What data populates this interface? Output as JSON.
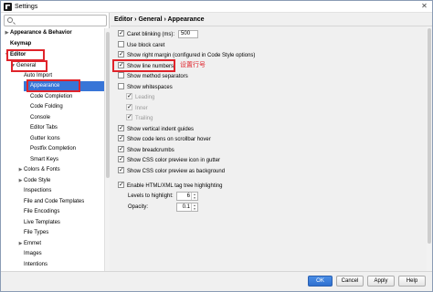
{
  "window": {
    "title": "Settings",
    "close_glyph": "✕"
  },
  "search": {
    "value": "",
    "placeholder": ""
  },
  "tree": [
    {
      "label": "Appearance & Behavior",
      "arrow": "▶",
      "bold": true
    },
    {
      "label": "Keymap",
      "arrow": "",
      "bold": true
    },
    {
      "label": "Editor",
      "arrow": "▼",
      "bold": true
    },
    {
      "label": "General",
      "arrow": "▼"
    },
    {
      "label": "Auto Import",
      "arrow": ""
    },
    {
      "label": "Appearance",
      "arrow": "",
      "selected": true
    },
    {
      "label": "Code Completion",
      "arrow": ""
    },
    {
      "label": "Code Folding",
      "arrow": ""
    },
    {
      "label": "Console",
      "arrow": ""
    },
    {
      "label": "Editor Tabs",
      "arrow": ""
    },
    {
      "label": "Gutter Icons",
      "arrow": ""
    },
    {
      "label": "Postfix Completion",
      "arrow": ""
    },
    {
      "label": "Smart Keys",
      "arrow": ""
    },
    {
      "label": "Colors & Fonts",
      "arrow": "▶"
    },
    {
      "label": "Code Style",
      "arrow": "▶"
    },
    {
      "label": "Inspections",
      "arrow": ""
    },
    {
      "label": "File and Code Templates",
      "arrow": ""
    },
    {
      "label": "File Encodings",
      "arrow": ""
    },
    {
      "label": "Live Templates",
      "arrow": ""
    },
    {
      "label": "File Types",
      "arrow": ""
    },
    {
      "label": "Emmet",
      "arrow": "▶"
    },
    {
      "label": "Images",
      "arrow": ""
    },
    {
      "label": "Intentions",
      "arrow": ""
    }
  ],
  "breadcrumb": "Editor › General › Appearance",
  "options": {
    "caret_blinking": {
      "label": "Caret blinking (ms):",
      "checked": true,
      "value": "500"
    },
    "block_caret": {
      "label": "Use block caret",
      "checked": false
    },
    "right_margin": {
      "label": "Show right margin (configured in Code Style options)",
      "checked": true
    },
    "line_numbers": {
      "label": "Show line numbers",
      "checked": true
    },
    "method_separators": {
      "label": "Show method separators",
      "checked": false
    },
    "whitespaces": {
      "label": "Show whitespaces",
      "checked": false
    },
    "leading": {
      "label": "Leading",
      "checked": true
    },
    "inner": {
      "label": "Inner",
      "checked": true
    },
    "trailing": {
      "label": "Trailing",
      "checked": true
    },
    "indent_guides": {
      "label": "Show vertical indent guides",
      "checked": true
    },
    "code_lens": {
      "label": "Show code lens on scrollbar hover",
      "checked": true
    },
    "breadcrumbs": {
      "label": "Show breadcrumbs",
      "checked": true
    },
    "css_gutter": {
      "label": "Show CSS color preview icon in gutter",
      "checked": true
    },
    "css_background": {
      "label": "Show CSS color preview as background",
      "checked": true
    },
    "html_tag_tree": {
      "label": "Enable HTML/XML tag tree highlighting",
      "checked": true
    },
    "levels": {
      "label": "Levels to highlight:",
      "value": "6"
    },
    "opacity": {
      "label": "Opacity:",
      "value": "0.1"
    }
  },
  "annotation": "设置行号",
  "buttons": {
    "ok": "OK",
    "cancel": "Cancel",
    "apply": "Apply",
    "help": "Help"
  },
  "colors": {
    "selection": "#3875d7",
    "annotation_red": "#e0242b",
    "ok_blue": "#2f6fcf"
  }
}
